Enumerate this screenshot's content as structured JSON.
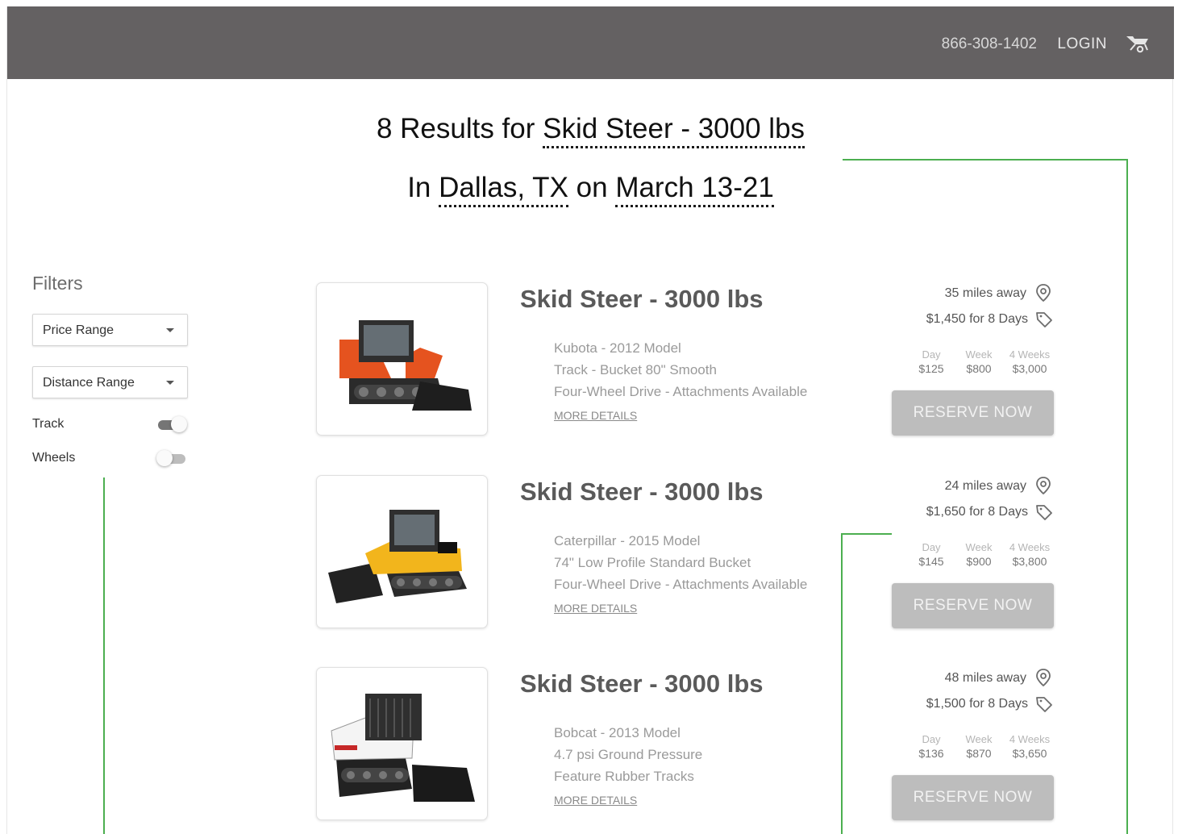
{
  "header": {
    "phone": "866-308-1402",
    "login_label": "LOGIN",
    "cart_icon": "wheelbarrow-cart-icon",
    "bg_color": "#646162"
  },
  "search": {
    "results_prefix": "8 Results for ",
    "equipment": "Skid Steer - 3000 lbs",
    "in_label": "In ",
    "location": "Dallas, TX",
    "on_label": " on ",
    "dates": "March 13-21"
  },
  "filters": {
    "title": "Filters",
    "price_range": "Price Range",
    "distance_range": "Distance Range",
    "track_label": "Track",
    "track_on": true,
    "wheels_label": "Wheels",
    "wheels_on": false
  },
  "results": [
    {
      "title": "Skid Steer - 3000 lbs",
      "details": [
        "Kubota - 2012 Model",
        "Track - Bucket 80\" Smooth",
        "Four-Wheel Drive - Attachments Available"
      ],
      "more": "MORE DETAILS",
      "distance": "35 miles away",
      "total": "$1,450 for 8 Days",
      "rates": {
        "day_label": "Day",
        "day": "$125",
        "week_label": "Week",
        "week": "$800",
        "month_label": "4 Weeks",
        "month": "$3,000"
      },
      "reserve": "RESERVE NOW",
      "body_color": "#e5531f"
    },
    {
      "title": "Skid Steer - 3000 lbs",
      "details": [
        "Caterpillar - 2015 Model",
        "74\" Low Profile Standard Bucket",
        "Four-Wheel Drive - Attachments Available"
      ],
      "more": "MORE DETAILS",
      "distance": "24 miles away",
      "total": "$1,650 for 8 Days",
      "rates": {
        "day_label": "Day",
        "day": "$145",
        "week_label": "Week",
        "week": "$900",
        "month_label": "4 Weeks",
        "month": "$3,800"
      },
      "reserve": "RESERVE NOW",
      "body_color": "#f2b51c"
    },
    {
      "title": "Skid Steer - 3000 lbs",
      "details": [
        "Bobcat - 2013 Model",
        "4.7 psi Ground Pressure",
        "Feature Rubber Tracks"
      ],
      "more": "MORE DETAILS",
      "distance": "48 miles away",
      "total": "$1,500 for 8 Days",
      "rates": {
        "day_label": "Day",
        "day": "$136",
        "week_label": "Week",
        "week": "$870",
        "month_label": "4 Weeks",
        "month": "$3,650"
      },
      "reserve": "RESERVE NOW",
      "body_color": "#f4f4f4"
    }
  ],
  "colors": {
    "accent_line": "#4caf50",
    "button": "#bdbdbd"
  }
}
